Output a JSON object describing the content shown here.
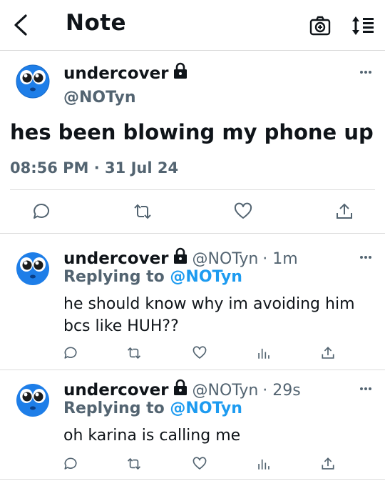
{
  "header": {
    "title": "Note"
  },
  "main_tweet": {
    "display_name": "undercover",
    "handle": "@NOTyn",
    "text": "hes been blowing my phone up",
    "timestamp": "08:56 PM · 31 Jul 24"
  },
  "replies": [
    {
      "display_name": "undercover",
      "handle": "@NOTyn",
      "age": "· 1m",
      "replying_prefix": "Replying to",
      "replying_handle": "@NOTyn",
      "line1": "he should know why im avoiding him",
      "line2": "bcs like HUH??"
    },
    {
      "display_name": "undercover",
      "handle": "@NOTyn",
      "age": "· 29s",
      "replying_prefix": "Replying to",
      "replying_handle": "@NOTyn",
      "line1": "oh karina is calling me",
      "line2": ""
    }
  ],
  "colors": {
    "secondary": "#536471",
    "accent": "#1d9bf0",
    "divider": "#dcdcdc"
  },
  "icons": {
    "header": [
      "back-icon",
      "camera-icon",
      "sort-icon"
    ],
    "actions": [
      "reply-icon",
      "retweet-icon",
      "like-icon",
      "views-icon",
      "share-icon"
    ]
  }
}
